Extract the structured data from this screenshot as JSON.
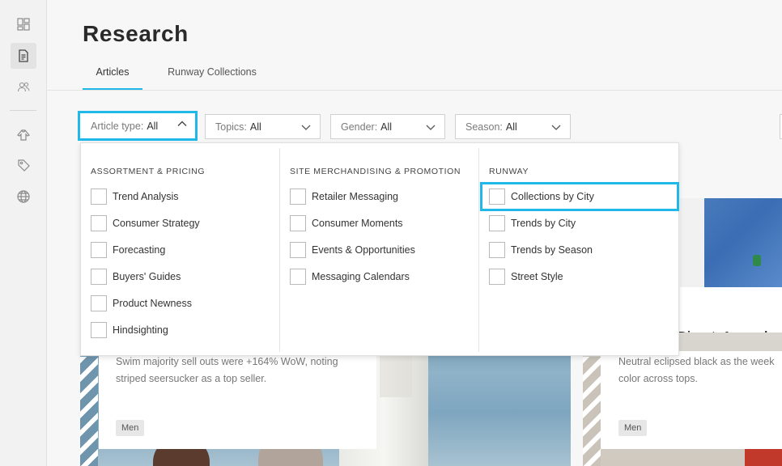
{
  "sidebar": {
    "items": [
      {
        "icon": "dashboard-grid-icon"
      },
      {
        "icon": "document-report-icon",
        "active": true
      },
      {
        "icon": "users-icon"
      },
      {
        "icon": "clothing-hanger-icon"
      },
      {
        "icon": "price-tag-icon"
      },
      {
        "icon": "globe-icon"
      }
    ]
  },
  "header": {
    "title": "Research",
    "tabs": [
      {
        "label": "Articles",
        "active": true
      },
      {
        "label": "Runway Collections",
        "active": false
      }
    ]
  },
  "filters": [
    {
      "label": "Article type:",
      "value": "All",
      "open": true
    },
    {
      "label": "Topics:",
      "value": "All",
      "open": false
    },
    {
      "label": "Gender:",
      "value": "All",
      "open": false
    },
    {
      "label": "Season:",
      "value": "All",
      "open": false
    }
  ],
  "dropdown": {
    "columns": [
      {
        "heading": "ASSORTMENT & PRICING",
        "options": [
          "Trend Analysis",
          "Consumer Strategy",
          "Forecasting",
          "Buyers' Guides",
          "Product Newness",
          "Hindsighting"
        ]
      },
      {
        "heading": "SITE MERCHANDISING & PROMOTION",
        "options": [
          "Retailer Messaging",
          "Consumer Moments",
          "Events & Opportunities",
          "Messaging Calendars"
        ]
      },
      {
        "heading": "RUNWAY",
        "options": [
          "Collections by City",
          "Trends by City",
          "Trends by Season",
          "Street Style"
        ]
      }
    ],
    "highlighted": "Collections by City"
  },
  "cards": [
    {
      "text_line1": "Swim majority sell outs were +164% WoW, noting",
      "text_line2": "striped seersucker as a top seller.",
      "tag": "Men"
    },
    {
      "title": "Digest: Apparel +",
      "text_line1": "Neutral eclipsed black as the week",
      "text_line2": "color across tops.",
      "tag": "Men"
    }
  ],
  "colors": {
    "accent": "#1fb8e8",
    "background": "#f7f7f7"
  }
}
